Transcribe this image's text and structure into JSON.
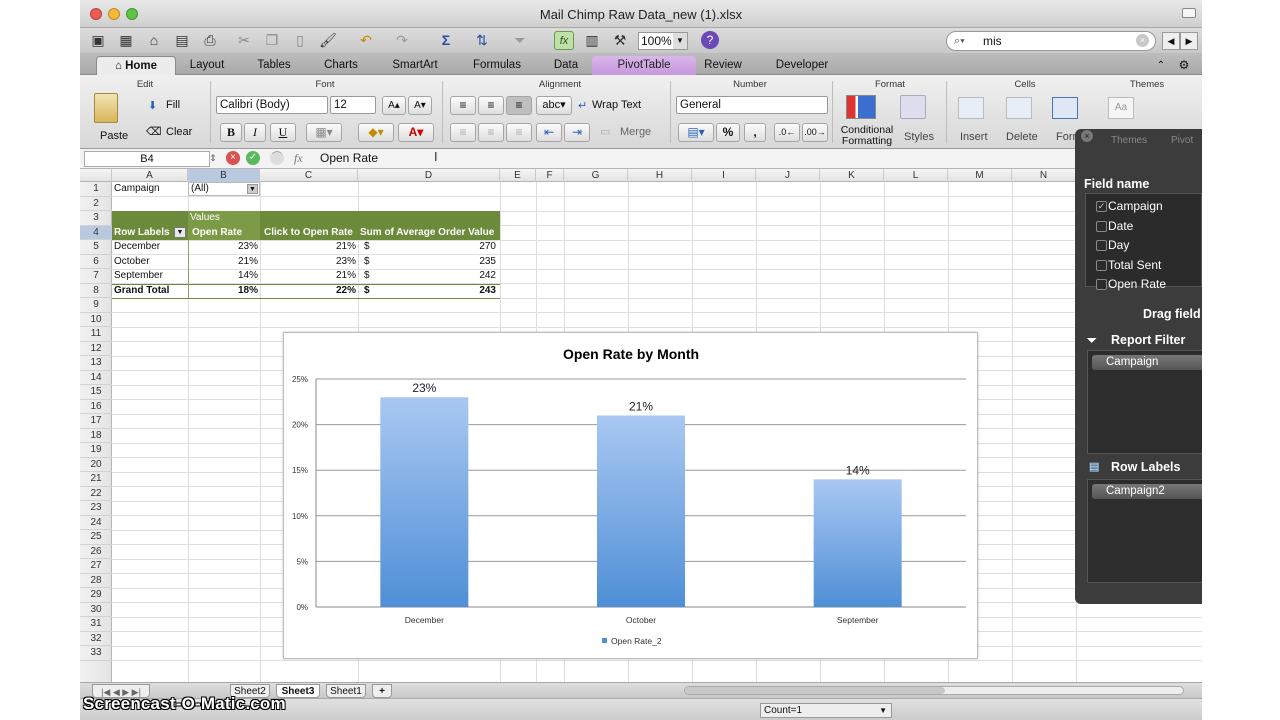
{
  "window": {
    "title": "Mail Chimp Raw Data_new (1).xlsx"
  },
  "toolbar": {
    "zoom": "100%",
    "search_value": "mis"
  },
  "tabs": [
    "Home",
    "Layout",
    "Tables",
    "Charts",
    "SmartArt",
    "Formulas",
    "Data",
    "PivotTable",
    "Review",
    "Developer"
  ],
  "ribbon": {
    "groups": [
      "Edit",
      "Font",
      "Alignment",
      "Number",
      "Format",
      "Cells",
      "Themes"
    ],
    "paste": "Paste",
    "fill": "Fill",
    "clear": "Clear",
    "font_name": "Calibri (Body)",
    "font_size": "12",
    "bold": "B",
    "italic": "I",
    "underline": "U",
    "wrap_text": "Wrap Text",
    "merge": "Merge",
    "abc": "abc",
    "number_format": "General",
    "percent": "%",
    "comma": ",",
    "conditional_formatting": "Conditional Formatting",
    "styles": "Styles",
    "insert": "Insert",
    "delete": "Delete",
    "format": "Form",
    "themes": "Themes"
  },
  "formula_bar": {
    "name_box": "B4",
    "fx": "fx",
    "value": "Open Rate"
  },
  "columns": [
    "A",
    "B",
    "C",
    "D",
    "E",
    "F",
    "G",
    "H",
    "I",
    "J",
    "K",
    "L",
    "M",
    "N"
  ],
  "rows": [
    "1",
    "2",
    "3",
    "4",
    "5",
    "6",
    "7",
    "8",
    "9",
    "10",
    "11",
    "12",
    "13",
    "14",
    "15",
    "16",
    "17",
    "18",
    "19",
    "20",
    "21",
    "22",
    "23",
    "24",
    "25",
    "26",
    "27",
    "28",
    "29",
    "30",
    "31",
    "32",
    "33"
  ],
  "pivot": {
    "filter_label": "Campaign",
    "filter_value": "(All)",
    "values_label": "Values",
    "headers": [
      "Row Labels",
      "Open Rate",
      "Click to Open Rate",
      "Sum of Average Order Value"
    ],
    "rows": [
      {
        "label": "December",
        "open": "23%",
        "cto": "21%",
        "cur": "$",
        "aov": "270"
      },
      {
        "label": "October",
        "open": "21%",
        "cto": "23%",
        "cur": "$",
        "aov": "235"
      },
      {
        "label": "September",
        "open": "14%",
        "cto": "21%",
        "cur": "$",
        "aov": "242"
      }
    ],
    "total": {
      "label": "Grand Total",
      "open": "18%",
      "cto": "22%",
      "cur": "$",
      "aov": "243"
    }
  },
  "chart_data": {
    "type": "bar",
    "title": "Open Rate by Month",
    "categories": [
      "December",
      "October",
      "September"
    ],
    "series": [
      {
        "name": "Open Rate_2",
        "values": [
          0.23,
          0.21,
          0.14
        ]
      }
    ],
    "data_labels": [
      "23%",
      "21%",
      "14%"
    ],
    "y_ticks": [
      "0%",
      "5%",
      "10%",
      "15%",
      "20%",
      "25%"
    ],
    "ylim": [
      0,
      0.25
    ],
    "grid": true,
    "legend_position": "bottom",
    "bar_color_top": "#a9c8f2",
    "bar_color_bottom": "#4f8fd6"
  },
  "pivot_panel": {
    "title": "Themes",
    "title2": "Pivot",
    "field_name_label": "Field name",
    "fields": [
      {
        "name": "Campaign",
        "checked": true
      },
      {
        "name": "Date",
        "checked": false
      },
      {
        "name": "Day",
        "checked": false
      },
      {
        "name": "Total Sent",
        "checked": false
      },
      {
        "name": "Open Rate",
        "checked": false
      }
    ],
    "drag_hint": "Drag field",
    "report_filter_label": "Report Filter",
    "report_filter_item": "Campaign",
    "row_labels_label": "Row Labels",
    "row_labels_item": "Campaign2"
  },
  "sheets": [
    "Sheet2",
    "Sheet3",
    "Sheet1"
  ],
  "active_sheet": "Sheet3",
  "status": {
    "count": "Count=1"
  },
  "watermark": "Screencast-O-Matic.com"
}
